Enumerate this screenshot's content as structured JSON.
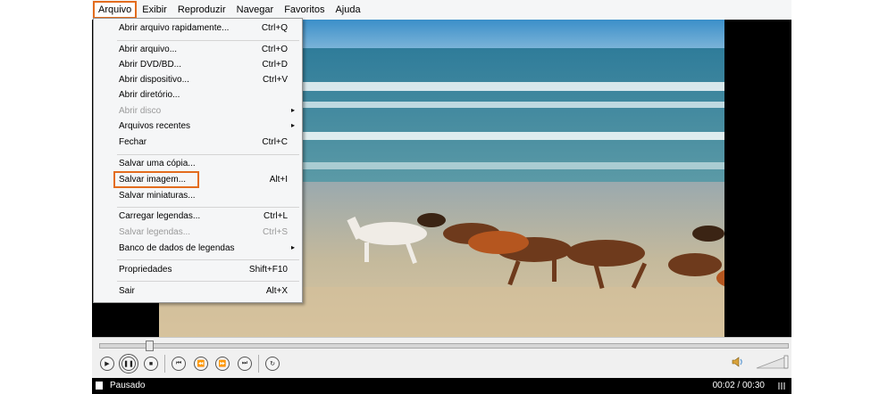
{
  "menubar": {
    "items": [
      "Arquivo",
      "Exibir",
      "Reproduzir",
      "Navegar",
      "Favoritos",
      "Ajuda"
    ]
  },
  "file_menu": {
    "items": [
      {
        "label": "Abrir arquivo rapidamente...",
        "shortcut": "Ctrl+Q"
      },
      {
        "label": "Abrir arquivo...",
        "shortcut": "Ctrl+O"
      },
      {
        "label": "Abrir DVD/BD...",
        "shortcut": "Ctrl+D"
      },
      {
        "label": "Abrir dispositivo...",
        "shortcut": "Ctrl+V"
      },
      {
        "label": "Abrir diretório...",
        "shortcut": ""
      },
      {
        "label": "Abrir disco",
        "shortcut": "",
        "disabled": true,
        "submenu": true
      },
      {
        "label": "Arquivos recentes",
        "shortcut": "",
        "submenu": true
      },
      {
        "label": "Fechar",
        "shortcut": "Ctrl+C"
      },
      {
        "label": "Salvar uma cópia...",
        "shortcut": "",
        "disabled": true
      },
      {
        "label": "Salvar imagem...",
        "shortcut": "Alt+I",
        "highlighted": true
      },
      {
        "label": "Salvar miniaturas...",
        "shortcut": ""
      },
      {
        "label": "Carregar legendas...",
        "shortcut": "Ctrl+L"
      },
      {
        "label": "Salvar legendas...",
        "shortcut": "Ctrl+S",
        "disabled": true
      },
      {
        "label": "Banco de dados de legendas",
        "shortcut": "",
        "submenu": true
      },
      {
        "label": "Propriedades",
        "shortcut": "Shift+F10"
      },
      {
        "label": "Sair",
        "shortcut": "Alt+X"
      }
    ]
  },
  "player": {
    "seek_progress_fraction": 0.067,
    "controls": [
      "play-icon",
      "pause-icon",
      "stop-icon",
      "skip-back-icon",
      "rewind-icon",
      "fast-forward-icon",
      "skip-forward-icon",
      "frame-step-icon"
    ]
  },
  "status": {
    "state": "Pausado",
    "time": "00:02 / 00:30"
  },
  "colors": {
    "highlight": "#e36c1e"
  }
}
